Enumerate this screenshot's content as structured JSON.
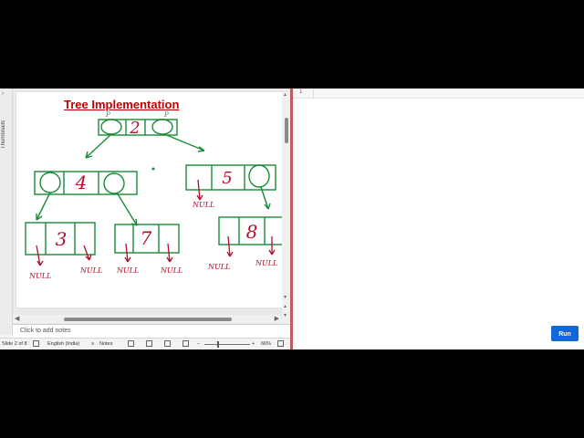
{
  "slide": {
    "title": "Tree Implementation",
    "root_value": "2",
    "left_child_value": "4",
    "right_child_value": "5",
    "leaf_values": [
      "3",
      "7",
      "8"
    ],
    "null_labels": [
      "NULL",
      "NULL",
      "NULL",
      "NULL",
      "NULL",
      "NULL",
      "NULL."
    ],
    "right_child_null_label": "NULL",
    "pointer_marks": [
      "P",
      "P"
    ],
    "ink_color": "#1a8a3a",
    "value_color": "#b0102a",
    "null_color": "#b0102a"
  },
  "sidebar": {
    "thumbnails_label": "Thumbnails",
    "collapse_icon": "chevron-right-icon"
  },
  "notes": {
    "placeholder": "Click to add notes"
  },
  "statusbar": {
    "slide_info": "Slide 2 of 8",
    "language": "English (India)",
    "notes_label": "Notes",
    "zoom": "66%"
  },
  "editor": {
    "line_number": "1",
    "run_label": "Run",
    "run_color": "#1366d6"
  }
}
